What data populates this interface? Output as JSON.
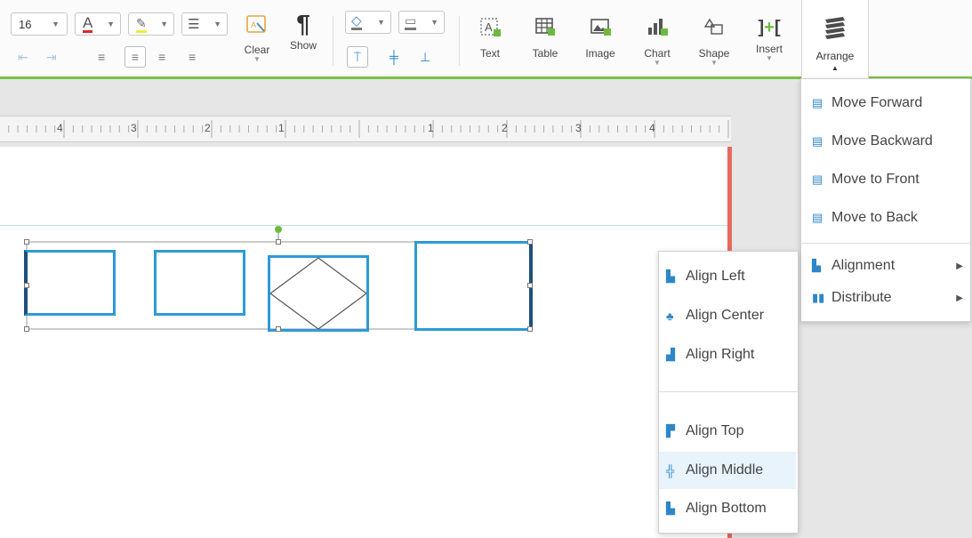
{
  "toolbar": {
    "font_size": "16",
    "buttons": {
      "clear": "Clear",
      "show": "Show",
      "text": "Text",
      "table": "Table",
      "image": "Image",
      "chart": "Chart",
      "shape": "Shape",
      "insert": "Insert",
      "arrange": "Arrange"
    }
  },
  "ruler": {
    "labels": [
      "4",
      "3",
      "2",
      "1",
      "1",
      "2",
      "3",
      "4"
    ]
  },
  "arrange_menu": {
    "items": [
      {
        "label": "Move Forward",
        "icon": "move-forward-icon"
      },
      {
        "label": "Move Backward",
        "icon": "move-backward-icon"
      },
      {
        "label": "Move to Front",
        "icon": "move-to-front-icon"
      },
      {
        "label": "Move to Back",
        "icon": "move-to-back-icon"
      }
    ],
    "submenus": [
      {
        "label": "Alignment",
        "icon": "alignment-icon"
      },
      {
        "label": "Distribute",
        "icon": "distribute-icon"
      }
    ]
  },
  "alignment_submenu": {
    "items": [
      {
        "label": "Align Left",
        "icon": "align-left-icon"
      },
      {
        "label": "Align Center",
        "icon": "align-center-icon"
      },
      {
        "label": "Align Right",
        "icon": "align-right-icon"
      },
      {
        "label": "Align Top",
        "icon": "align-top-icon"
      },
      {
        "label": "Align Middle",
        "icon": "align-middle-icon"
      },
      {
        "label": "Align Bottom",
        "icon": "align-bottom-icon"
      }
    ],
    "highlighted": "Align Middle"
  },
  "colors": {
    "accent_green": "#7ac143",
    "shape_blue": "#2d9ad6",
    "page_margin_red": "#e66a5e",
    "highlight": "#e8f3fb"
  }
}
